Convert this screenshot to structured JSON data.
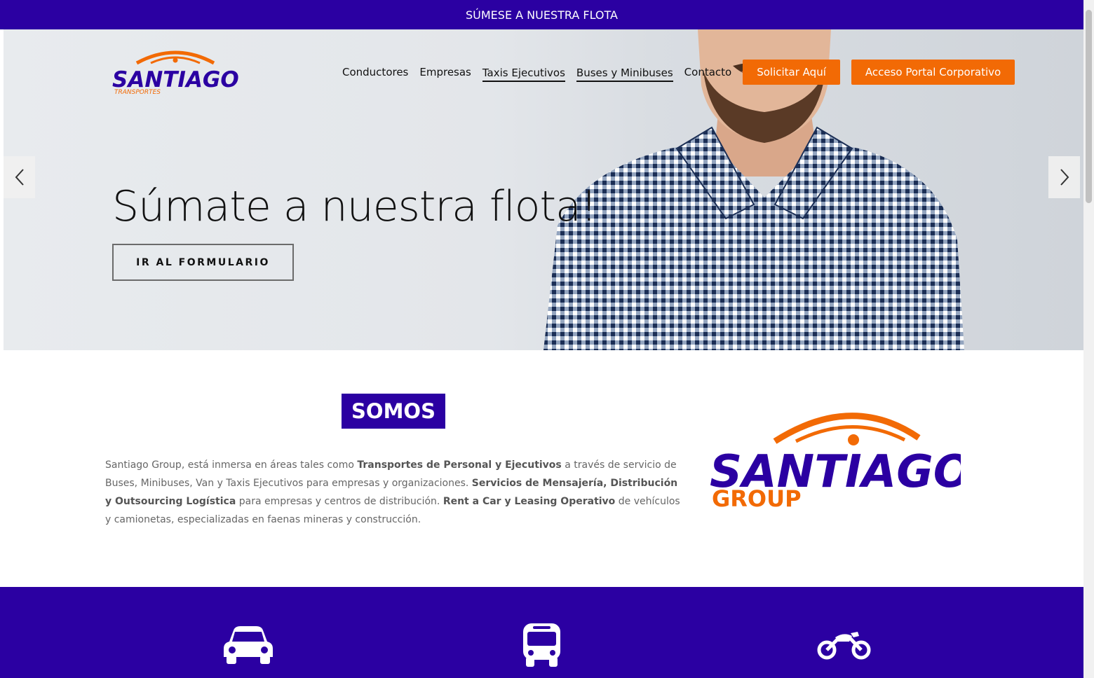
{
  "topbar": {
    "text": "SÚMESE A NUESTRA FLOTA"
  },
  "brand": {
    "logo_small_text": "SANTIAGO",
    "logo_small_sub": "TRANSPORTES",
    "logo_big_text": "SANTIAGO",
    "logo_big_sub": "GROUP"
  },
  "nav": {
    "items": [
      {
        "label": "Conductores",
        "active": false
      },
      {
        "label": "Empresas",
        "active": false
      },
      {
        "label": "Taxis Ejecutivos",
        "active": true
      },
      {
        "label": "Buses y Minibuses",
        "active": true
      },
      {
        "label": "Contacto",
        "active": false
      }
    ],
    "cta1": "Solicitar Aquí",
    "cta2": "Acceso Portal Corporativo"
  },
  "hero": {
    "title": "Súmate a nuestra flota!",
    "button": "IR AL FORMULARIO",
    "prev_icon": "chevron-left-icon",
    "next_icon": "chevron-right-icon"
  },
  "somos": {
    "heading": "SOMOS",
    "p1": "Santiago Group, está inmersa en áreas tales como ",
    "b1": "Transportes de Personal y Ejecutivos",
    "p2": " a través de servicio de Buses, Minibuses, Van y Taxis Ejecutivos para empresas y organizaciones. ",
    "b2": "Servicios de Mensajería, Distribución y Outsourcing Logística",
    "p3": " para empresas y centros de distribución. ",
    "b3": "Rent a Car y Leasing Operativo",
    "p4": " de vehículos y camionetas, especializadas en faenas mineras y construcción."
  },
  "services": {
    "icons": [
      "car-icon",
      "bus-icon",
      "motorcycle-icon"
    ]
  },
  "colors": {
    "brand_blue": "#2b00a2",
    "brand_orange": "#f26a05"
  }
}
